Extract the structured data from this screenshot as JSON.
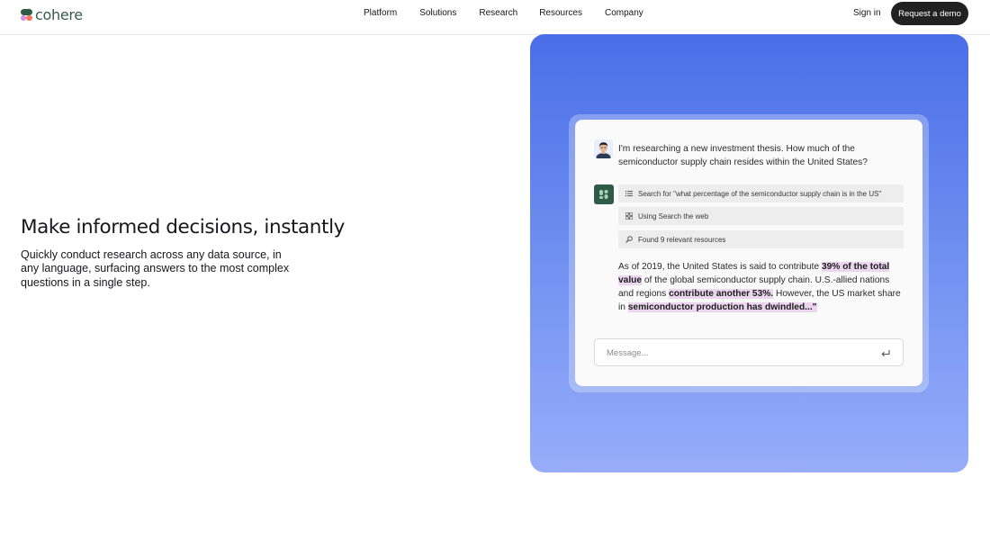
{
  "brand": {
    "name": "cohere"
  },
  "nav": {
    "items": [
      "Platform",
      "Solutions",
      "Research",
      "Resources",
      "Company"
    ],
    "sign_in": "Sign in",
    "cta": "Request a demo"
  },
  "hero": {
    "headline": "Make informed decisions, instantly",
    "subcopy": "Quickly conduct research across any data source, in any language, surfacing answers to the most complex questions in a single step."
  },
  "chat": {
    "user_message": "I'm researching a new investment thesis. How much of the semiconductor supply chain resides within the United States?",
    "steps": [
      {
        "icon": "list-icon",
        "text": "Search for \"what percentage of the semiconductor supply chain is in the US\""
      },
      {
        "icon": "grid-icon",
        "text": "Using Search the web"
      },
      {
        "icon": "search-icon",
        "text": "Found 9 relevant resources"
      }
    ],
    "answer": {
      "p1": "As of 2019, the United States is said to contribute ",
      "h1": "39% of the total value",
      "p2": " of the global semiconductor supply chain. U.S.-allied nations and regions ",
      "h2": "contribute another 53%.",
      "p3": " However, the US market share in ",
      "h3": "semiconductor production has dwindled...\""
    },
    "input_placeholder": "Message..."
  },
  "colors": {
    "brand_green": "#39594d",
    "cta_bg": "#212121",
    "gradient_top": "#4a6ee8",
    "gradient_bottom": "#97adfa",
    "highlight": "#ecd6ef"
  }
}
